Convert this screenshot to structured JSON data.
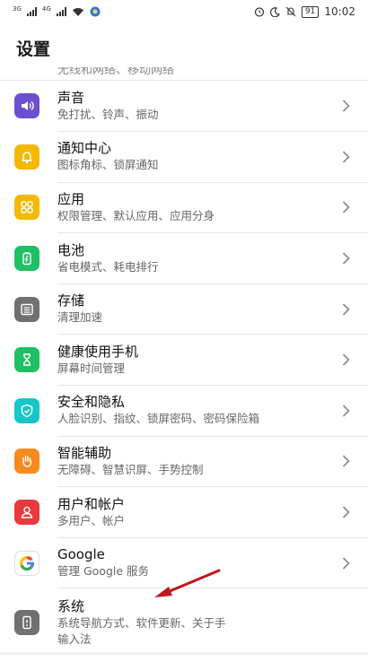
{
  "status_bar": {
    "net1": "3G",
    "net2": "4G",
    "battery": "91",
    "time": "10:02"
  },
  "title": "设置",
  "peek_text": "无线和网络、移动网络",
  "items": [
    {
      "title": "声音",
      "sub": "免打扰、铃声、振动",
      "icon": "speaker-icon",
      "color": "#6a4fd1"
    },
    {
      "title": "通知中心",
      "sub": "图标角标、锁屏通知",
      "icon": "bell-icon",
      "color": "#f5b800"
    },
    {
      "title": "应用",
      "sub": "权限管理、默认应用、应用分身",
      "icon": "apps-grid-icon",
      "color": "#f5b800"
    },
    {
      "title": "电池",
      "sub": "省电模式、耗电排行",
      "icon": "battery-icon",
      "color": "#1fbf63"
    },
    {
      "title": "存储",
      "sub": "清理加速",
      "icon": "storage-icon",
      "color": "#707070"
    },
    {
      "title": "健康使用手机",
      "sub": "屏幕时间管理",
      "icon": "hourglass-icon",
      "color": "#1fbf63"
    },
    {
      "title": "安全和隐私",
      "sub": "人脸识别、指纹、锁屏密码、密码保险箱",
      "icon": "shield-icon",
      "color": "#17c6c6"
    },
    {
      "title": "智能辅助",
      "sub": "无障碍、智慧识屏、手势控制",
      "icon": "hand-icon",
      "color": "#f58a1f"
    },
    {
      "title": "用户和帐户",
      "sub": "多用户、帐户",
      "icon": "user-icon",
      "color": "#e83a3a"
    },
    {
      "title": "Google",
      "sub": "管理 Google 服务",
      "icon": "google-icon",
      "color": "#ffffff"
    },
    {
      "title": "系统",
      "sub": "系统导航方式、软件更新、关于手",
      "sub2": "输入法",
      "icon": "system-icon",
      "color": "#707070"
    }
  ]
}
